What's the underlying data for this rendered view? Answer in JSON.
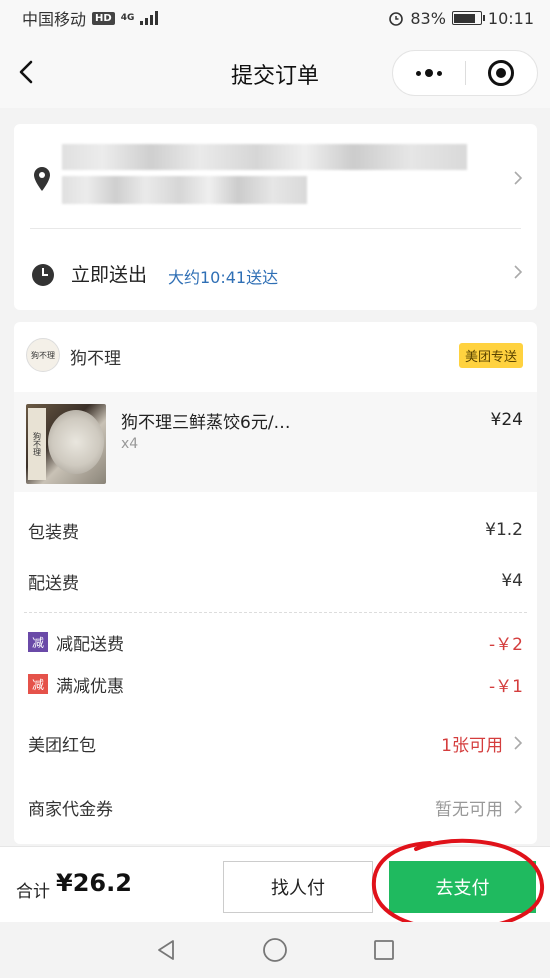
{
  "status_bar": {
    "carrier": "中国移动",
    "hd": "HD",
    "network": "4G",
    "battery": "83%",
    "time": "10:11"
  },
  "nav": {
    "title": "提交订单"
  },
  "delivery": {
    "time_label": "立即送出",
    "eta": "大约10:41送达"
  },
  "shop": {
    "logo_text": "狗不理",
    "name": "狗不理",
    "delivery_badge": "美团专送"
  },
  "item": {
    "name": "狗不理三鲜蒸饺6元/…",
    "qty": "x4",
    "price": "¥24"
  },
  "fees": [
    {
      "label": "包装费",
      "value": "¥1.2"
    },
    {
      "label": "配送费",
      "value": "¥4"
    }
  ],
  "discounts": [
    {
      "tag": "减",
      "tag_color": "#6a4aa8",
      "label": "减配送费",
      "amount": "-￥2"
    },
    {
      "tag": "减",
      "tag_color": "#e5524a",
      "label": "满减优惠",
      "amount": "-￥1"
    }
  ],
  "red_packet": {
    "label": "美团红包",
    "value": "1张可用",
    "value_color": "#d43d3d"
  },
  "voucher": {
    "label": "商家代金券",
    "value": "暂无可用",
    "value_color": "#999999"
  },
  "footer": {
    "total_label": "合计",
    "total_value": "¥26.2",
    "friend_pay": "找人付",
    "pay": "去支付"
  },
  "colors": {
    "pay_green": "#1fba5f",
    "eta_blue": "#2f6fb5",
    "discount_red": "#d43d3d",
    "badge_yellow": "#ffd23f"
  }
}
